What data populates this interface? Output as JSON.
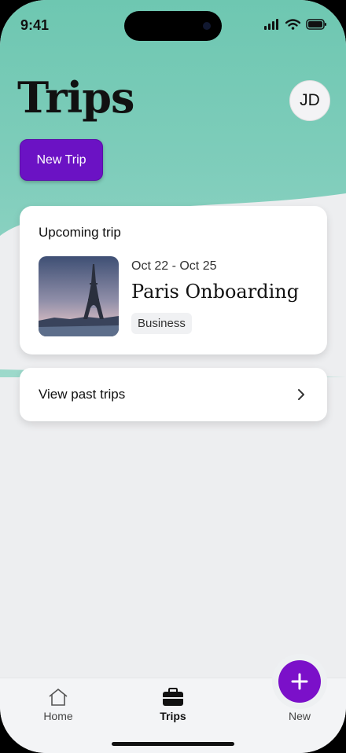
{
  "status": {
    "time": "9:41"
  },
  "header": {
    "title": "Trips",
    "avatar_initials": "JD"
  },
  "actions": {
    "new_trip_label": "New Trip"
  },
  "upcoming": {
    "section_label": "Upcoming trip",
    "dates": "Oct 22 - Oct 25",
    "name": "Paris Onboarding",
    "tag": "Business",
    "image_icon": "eiffel-tower-photo"
  },
  "past": {
    "label": "View past trips"
  },
  "tabbar": {
    "home_label": "Home",
    "trips_label": "Trips",
    "new_label": "New"
  },
  "colors": {
    "accent": "#6b12c4",
    "hero": "#6ec7b1",
    "background": "#edeef0"
  }
}
